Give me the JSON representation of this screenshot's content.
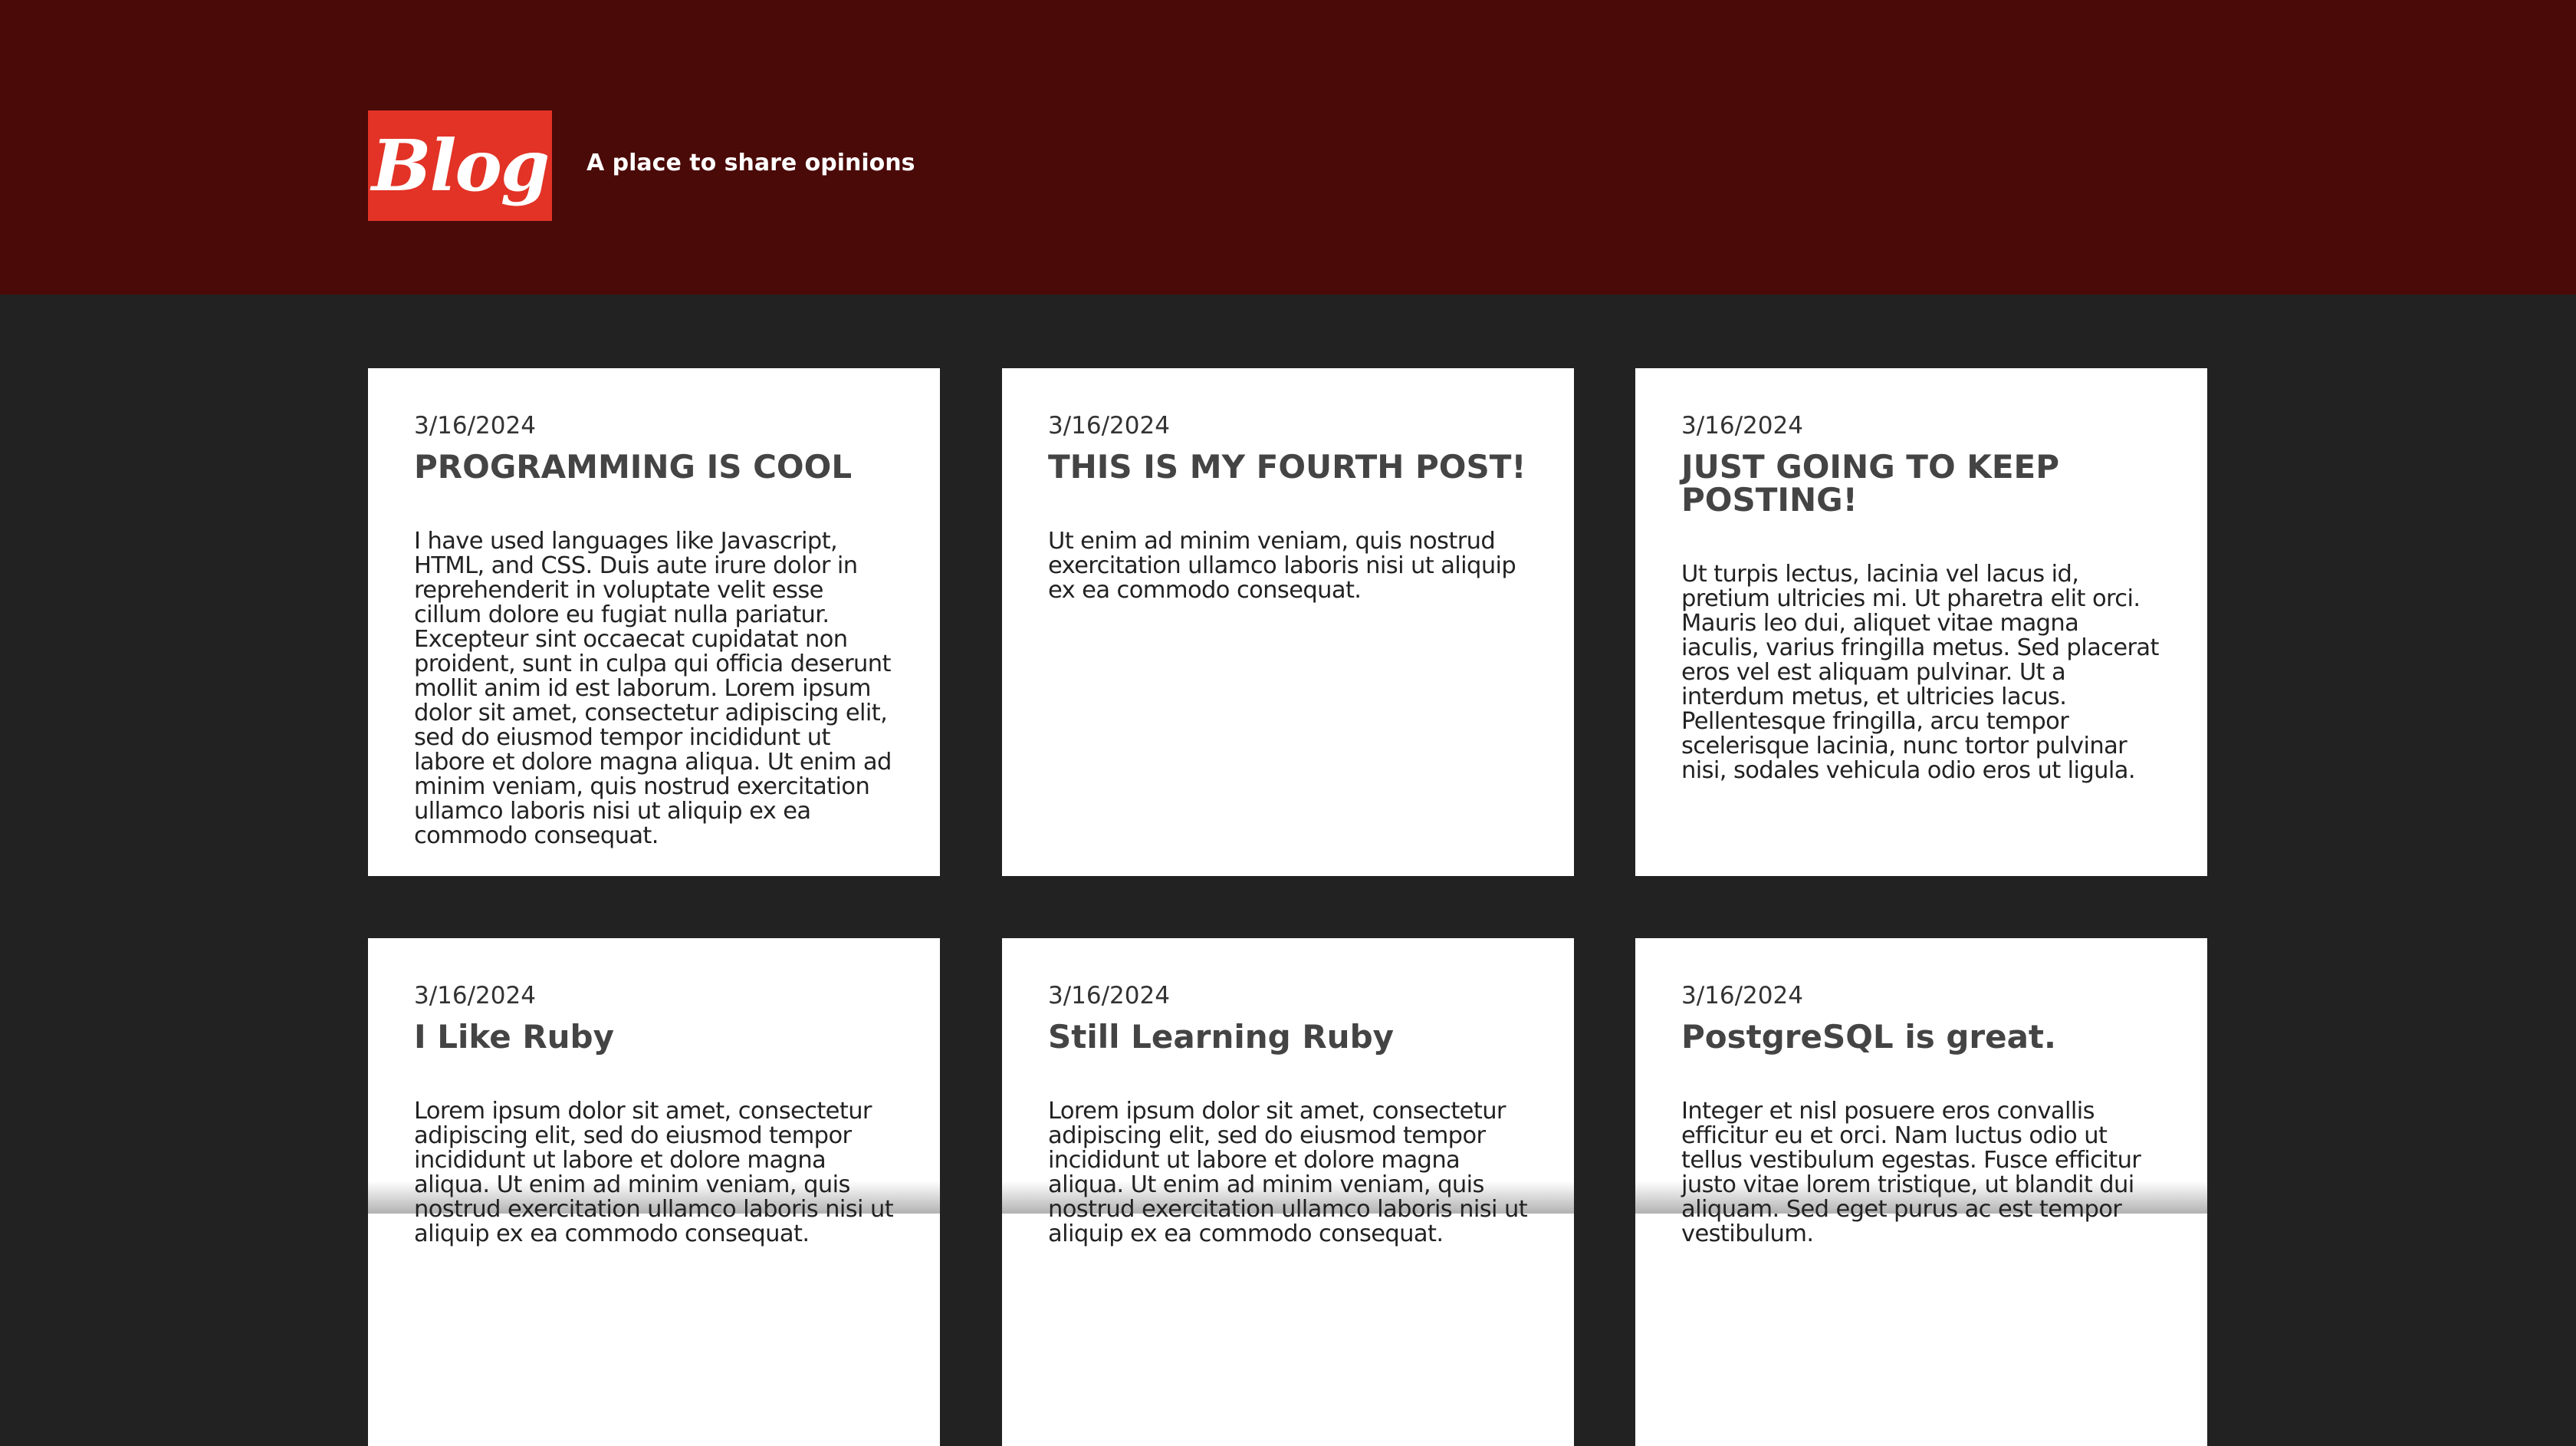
{
  "header": {
    "logo_text": "Blog",
    "tagline": "A place to share opinions",
    "background": "#4a0a07",
    "logo_color": "#e23326"
  },
  "posts": [
    {
      "date": "3/16/2024",
      "title": "PROGRAMMING IS COOL",
      "body": "I have used languages like Javascript, HTML, and CSS. Duis aute irure dolor in reprehenderit in voluptate velit esse cillum dolore eu fugiat nulla pariatur. Excepteur sint occaecat cupidatat non proident, sunt in culpa qui officia deserunt mollit anim id est laborum. Lorem ipsum dolor sit amet, consectetur adipiscing elit, sed do eiusmod tempor incididunt ut labore et dolore magna aliqua. Ut enim ad minim veniam, quis nostrud exercitation ullamco laboris nisi ut aliquip ex ea commodo consequat."
    },
    {
      "date": "3/16/2024",
      "title": "THIS IS MY FOURTH POST!",
      "body": "Ut enim ad minim veniam, quis nostrud exercitation ullamco laboris nisi ut aliquip ex ea commodo consequat."
    },
    {
      "date": "3/16/2024",
      "title": "JUST GOING TO KEEP POSTING!",
      "body": "Ut turpis lectus, lacinia vel lacus id, pretium ultricies mi. Ut pharetra elit orci. Mauris leo dui, aliquet vitae magna iaculis, varius fringilla metus. Sed placerat eros vel est aliquam pulvinar. Ut a interdum metus, et ultricies lacus. Pellentesque fringilla, arcu tempor scelerisque lacinia, nunc tortor pulvinar nisi, sodales vehicula odio eros ut ligula."
    },
    {
      "date": "3/16/2024",
      "title": "I Like Ruby",
      "body": "Lorem ipsum dolor sit amet, consectetur adipiscing elit, sed do eiusmod tempor incididunt ut labore et dolore magna aliqua. Ut enim ad minim veniam, quis nostrud exercitation ullamco laboris nisi ut aliquip ex ea commodo consequat."
    },
    {
      "date": "3/16/2024",
      "title": "Still Learning Ruby",
      "body": "Lorem ipsum dolor sit amet, consectetur adipiscing elit, sed do eiusmod tempor incididunt ut labore et dolore magna aliqua. Ut enim ad minim veniam, quis nostrud exercitation ullamco laboris nisi ut aliquip ex ea commodo consequat."
    },
    {
      "date": "3/16/2024",
      "title": "PostgreSQL is great.",
      "body": "Integer et nisl posuere eros convallis efficitur eu et orci. Nam luctus odio ut tellus vestibulum egestas. Fusce efficitur justo vitae lorem tristique, ut blandit dui aliquam. Sed eget purus ac est tempor vestibulum."
    }
  ]
}
